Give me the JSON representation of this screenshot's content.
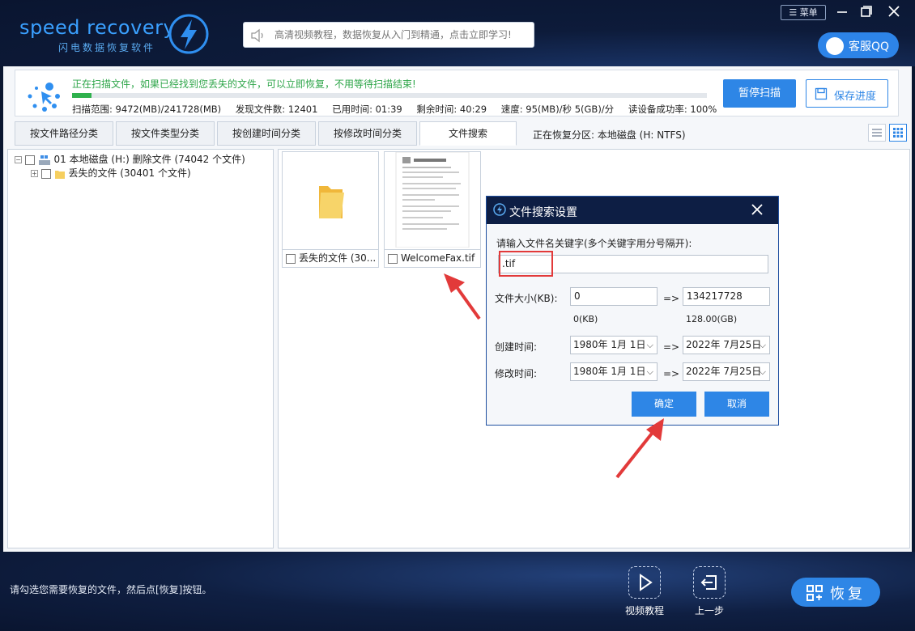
{
  "header": {
    "logo_text": "speed recovery",
    "logo_sub": "闪电数据恢复软件",
    "search_placeholder": "高清视频教程，数据恢复从入门到精通，点击立即学习!",
    "menu_label": "菜单",
    "qq_label": "客服QQ"
  },
  "scan": {
    "message": "正在扫描文件，如果已经找到您丢失的文件，可以立即恢复，不用等待扫描结束!",
    "progress_fraction": 0.03,
    "range": "扫描范围: 9472(MB)/241728(MB)",
    "found": "发现文件数: 12401",
    "elapsed": "已用时间: 01:39",
    "remaining": "剩余时间: 40:29",
    "speed": "速度: 95(MB)/秒  5(GB)/分",
    "read_rate": "读设备成功率: 100%",
    "pause_label": "暂停扫描",
    "save_label": "保存进度"
  },
  "tabs": [
    {
      "label": "按文件路径分类"
    },
    {
      "label": "按文件类型分类"
    },
    {
      "label": "按创建时间分类"
    },
    {
      "label": "按修改时间分类"
    },
    {
      "label": "文件搜索"
    }
  ],
  "partition_info": "正在恢复分区: 本地磁盘 (H: NTFS)",
  "tree": {
    "root": "01 本地磁盘 (H:) 删除文件  (74042 个文件)",
    "child": "丢失的文件    (30401 个文件)"
  },
  "files": [
    {
      "name": "丢失的文件  (30..."
    },
    {
      "name": "WelcomeFax.tif"
    }
  ],
  "dialog": {
    "title": "文件搜索设置",
    "keyword_label": "请输入文件名关键字(多个关键字用分号隔开):",
    "keyword_value": ".tif",
    "size_label": "文件大小(KB):",
    "size_min": "0",
    "size_max": "134217728",
    "size_min_unit": "0(KB)",
    "size_max_unit": "128.00(GB)",
    "arrow": "=>",
    "created_label": "创建时间:",
    "modified_label": "修改时间:",
    "created_from": "1980年  1月  1日",
    "created_to": "2022年  7月25日",
    "modified_from": "1980年  1月  1日",
    "modified_to": "2022年  7月25日",
    "ok_label": "确定",
    "cancel_label": "取消"
  },
  "footer": {
    "tip": "请勾选您需要恢复的文件，然后点[恢复]按钮。",
    "video_label": "视频教程",
    "back_label": "上一步",
    "recover_label": "恢复"
  },
  "colors": {
    "accent": "#2e86e6",
    "dark_bg": "#0b1730",
    "progress": "#2fb14d",
    "scan_text": "#2fa64a",
    "highlight": "#e23a3a"
  }
}
